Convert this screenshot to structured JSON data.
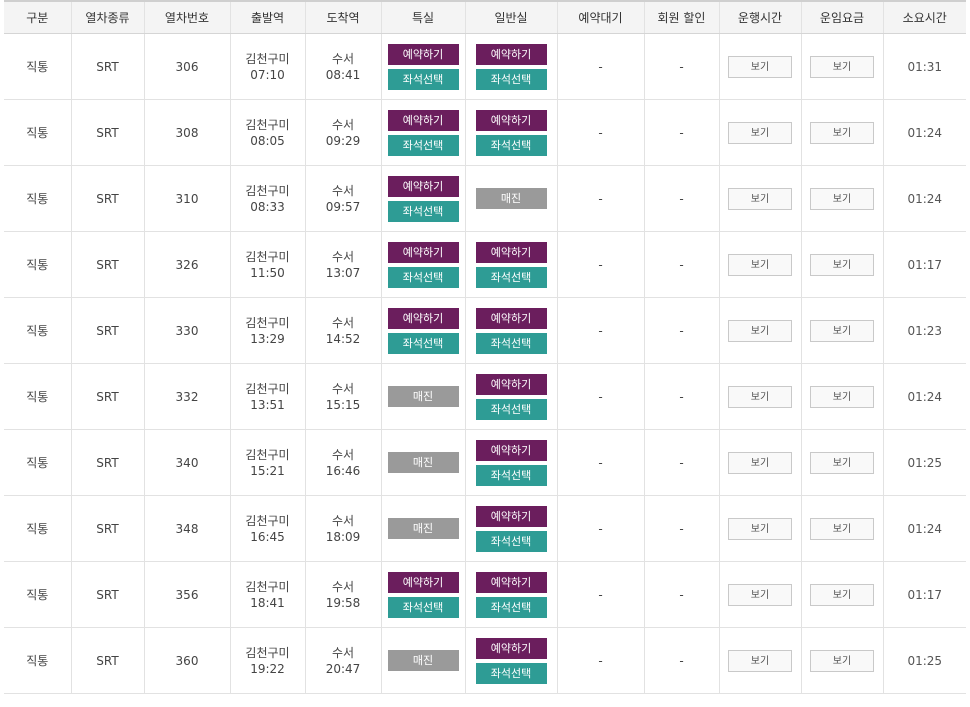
{
  "headers": [
    "구분",
    "열차종류",
    "열차번호",
    "출발역",
    "도착역",
    "특실",
    "일반실",
    "예약대기",
    "회원 할인",
    "운행시간",
    "운임요금",
    "소요시간"
  ],
  "labels": {
    "reserve": "예약하기",
    "seat": "좌석선택",
    "soldout": "매진",
    "view": "보기",
    "dash": "-"
  },
  "colors": {
    "reserve": "#6b1e5d",
    "seat": "#2e9c95",
    "soldout": "#9a9a9a"
  },
  "trains": [
    {
      "type": "직통",
      "kind": "SRT",
      "no": "306",
      "dep_station": "김천구미",
      "dep_time": "07:10",
      "arr_station": "수서",
      "arr_time": "08:41",
      "first_class": "available",
      "general": "available",
      "duration": "01:31"
    },
    {
      "type": "직통",
      "kind": "SRT",
      "no": "308",
      "dep_station": "김천구미",
      "dep_time": "08:05",
      "arr_station": "수서",
      "arr_time": "09:29",
      "first_class": "available",
      "general": "available",
      "duration": "01:24"
    },
    {
      "type": "직통",
      "kind": "SRT",
      "no": "310",
      "dep_station": "김천구미",
      "dep_time": "08:33",
      "arr_station": "수서",
      "arr_time": "09:57",
      "first_class": "available",
      "general": "soldout",
      "duration": "01:24"
    },
    {
      "type": "직통",
      "kind": "SRT",
      "no": "326",
      "dep_station": "김천구미",
      "dep_time": "11:50",
      "arr_station": "수서",
      "arr_time": "13:07",
      "first_class": "available",
      "general": "available",
      "duration": "01:17"
    },
    {
      "type": "직통",
      "kind": "SRT",
      "no": "330",
      "dep_station": "김천구미",
      "dep_time": "13:29",
      "arr_station": "수서",
      "arr_time": "14:52",
      "first_class": "available",
      "general": "available",
      "duration": "01:23"
    },
    {
      "type": "직통",
      "kind": "SRT",
      "no": "332",
      "dep_station": "김천구미",
      "dep_time": "13:51",
      "arr_station": "수서",
      "arr_time": "15:15",
      "first_class": "soldout",
      "general": "available",
      "duration": "01:24"
    },
    {
      "type": "직통",
      "kind": "SRT",
      "no": "340",
      "dep_station": "김천구미",
      "dep_time": "15:21",
      "arr_station": "수서",
      "arr_time": "16:46",
      "first_class": "soldout",
      "general": "available",
      "duration": "01:25"
    },
    {
      "type": "직통",
      "kind": "SRT",
      "no": "348",
      "dep_station": "김천구미",
      "dep_time": "16:45",
      "arr_station": "수서",
      "arr_time": "18:09",
      "first_class": "soldout",
      "general": "available",
      "duration": "01:24"
    },
    {
      "type": "직통",
      "kind": "SRT",
      "no": "356",
      "dep_station": "김천구미",
      "dep_time": "18:41",
      "arr_station": "수서",
      "arr_time": "19:58",
      "first_class": "available",
      "general": "available",
      "duration": "01:17"
    },
    {
      "type": "직통",
      "kind": "SRT",
      "no": "360",
      "dep_station": "김천구미",
      "dep_time": "19:22",
      "arr_station": "수서",
      "arr_time": "20:47",
      "first_class": "soldout",
      "general": "available",
      "duration": "01:25"
    }
  ]
}
